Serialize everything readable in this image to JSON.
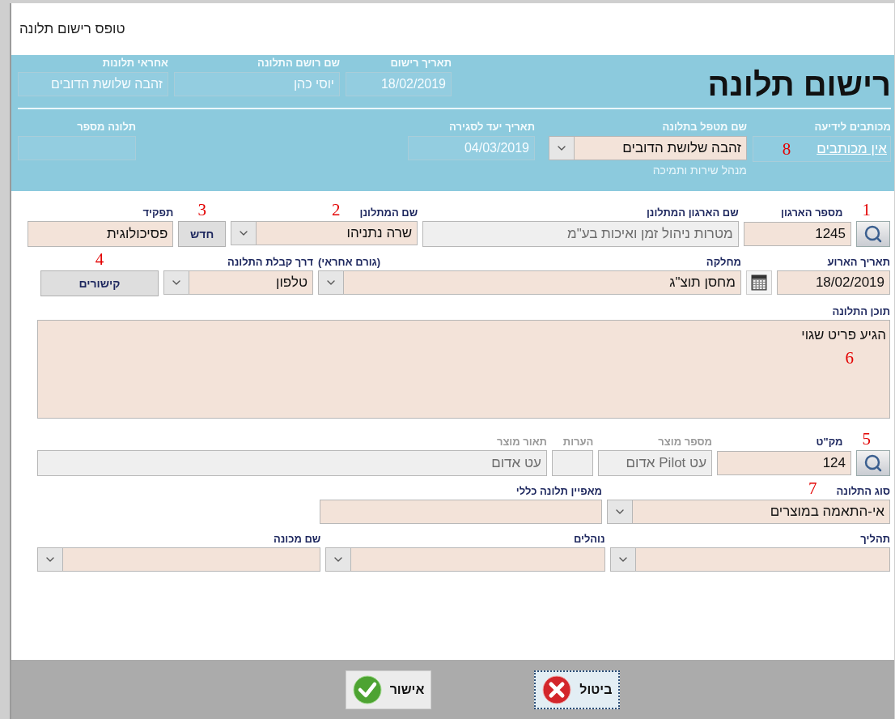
{
  "window": {
    "title": "טופס רישום תלונה"
  },
  "header": {
    "title": "רישום תלונה",
    "top_fields": [
      {
        "label": "תאריך רישום",
        "value": "18/02/2019"
      },
      {
        "label": "שם רושם התלונה",
        "value": "יוסי כהן"
      },
      {
        "label": "אחראי תלונות",
        "value": "זהבה שלושת הדובים"
      }
    ],
    "cc": {
      "label": "מכותבים לידיעה",
      "link": "אין מכותבים",
      "annotation": "8"
    },
    "handler": {
      "label": "שם מטפל בתלונה",
      "value": "זהבה שלושת הדובים",
      "note": "מנהל שירות ותמיכה"
    },
    "due": {
      "label": "תאריך יעד לסגירה",
      "value": "04/03/2019"
    },
    "number": {
      "label": "תלונה מספר"
    }
  },
  "rows": [
    [
      {
        "kind": "lookup",
        "label": "מספר הארגון",
        "value": "1245",
        "annotation": "1",
        "muted": false
      },
      {
        "kind": "readonly",
        "label": "שם הארגון המתלונן",
        "value": "מטרות ניהול זמן ואיכות בע\"מ",
        "muted": false
      },
      {
        "kind": "select",
        "label": "שם המתלונן",
        "value": "שרה נתניהו",
        "annotation": "2",
        "muted": false
      },
      {
        "kind": "button",
        "text": "חדש",
        "annotation": "3",
        "muted": false
      },
      {
        "kind": "text",
        "label": "תפקיד",
        "value": "פסיכולוגית",
        "muted": false
      }
    ],
    [
      {
        "kind": "date",
        "label": "תאריך הארוע",
        "value": "18/02/2019",
        "muted": false
      },
      {
        "kind": "select",
        "label": "מחלקה",
        "side_label": "(גורם אחראי)",
        "value": "מחסן תוצ\"ג",
        "muted": false
      },
      {
        "kind": "select",
        "label": "דרך קבלת התלונה",
        "value": "טלפון",
        "muted": false
      },
      {
        "kind": "button",
        "text": "קישורים",
        "annotation": "4",
        "muted": false
      }
    ],
    [
      {
        "kind": "textarea",
        "label": "תוכן התלונה",
        "value": "הגיע פריט שגוי",
        "annotation": "6",
        "muted": false
      }
    ],
    [
      {
        "kind": "lookup",
        "label": "מק\"ט",
        "value": "124",
        "annotation": "5",
        "muted": false
      },
      {
        "kind": "readonly",
        "label": "מספר מוצר",
        "value": "עט Pilot אדום",
        "muted": true
      },
      {
        "kind": "readonly",
        "label": "הערות",
        "muted": true
      },
      {
        "kind": "readonly",
        "label": "תאור מוצר",
        "value": "עט אדום",
        "muted": true
      }
    ],
    [
      {
        "kind": "select",
        "label": "סוג התלונה",
        "value": "אי-התאמה במוצרים",
        "annotation": "7",
        "muted": false
      },
      {
        "kind": "text",
        "label": "מאפיין תלונה כללי",
        "muted": false
      }
    ],
    [
      {
        "kind": "select",
        "label": "תהליך",
        "muted": false
      },
      {
        "kind": "select",
        "label": "נוהלים",
        "muted": false
      },
      {
        "kind": "select",
        "label": "שם מכונה",
        "muted": false
      }
    ]
  ],
  "buttons": [
    {
      "kind": "cancel",
      "label": "ביטול",
      "focused": true
    },
    {
      "kind": "ok",
      "label": "אישור",
      "focused": false
    }
  ]
}
